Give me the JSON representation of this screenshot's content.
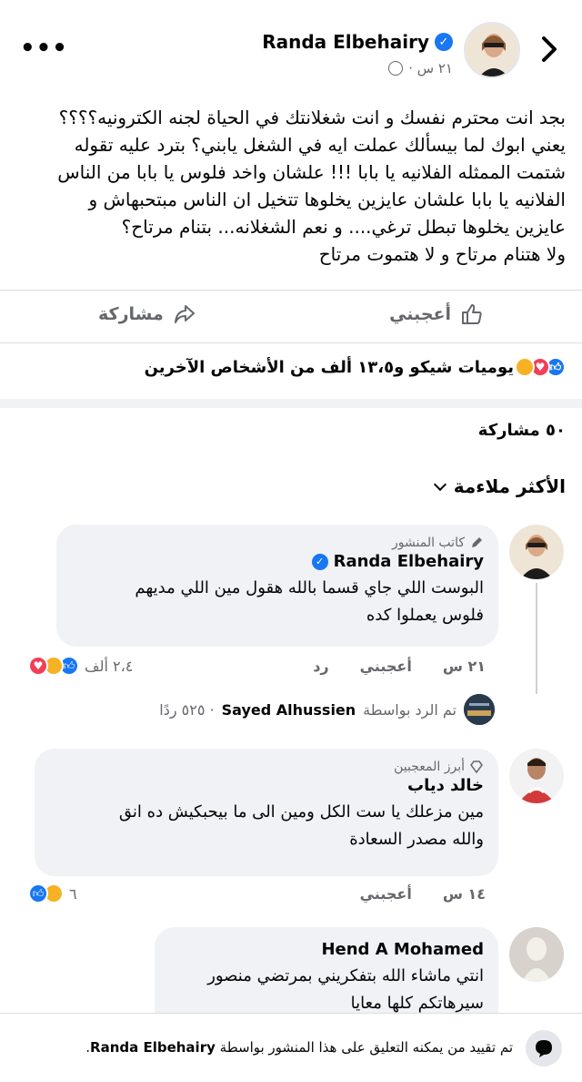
{
  "header": {
    "author": "Randa Elbehairy",
    "time": "٢١ س ·",
    "more_label": "•••"
  },
  "post": {
    "lines": [
      "بجد انت محترم نفسك و انت شغلانتك في الحياة لجنه الكترونيه؟؟؟؟",
      "يعني ابوك لما بيسألك عملت ايه في الشغل يابني؟ بترد عليه تقوله",
      "شتمت الممثله الفلانيه يا بابا !!! علشان واخد فلوس يا بابا من الناس",
      "الفلانيه يا بابا علشان عايزين يخلوها تتخيل ان الناس مبتحبهاش و",
      "عايزين يخلوها تبطل ترغي.... و نعم الشغلانه... بتنام مرتاح؟",
      "ولا هتنام مرتاح و لا هتموت مرتاح"
    ]
  },
  "actions": {
    "like_label": "أعجبني",
    "share_label": "مشاركة"
  },
  "reactions": {
    "summary": "يوميات شيكو و١٣،٥ ألف من الأشخاص الآخرين"
  },
  "shares": {
    "count_label": "٥٠ مشاركة"
  },
  "sort": {
    "label": "الأكثر ملاءمة"
  },
  "comments": [
    {
      "badge": "كاتب المنشور",
      "name": "Randa Elbehairy",
      "text_lines": [
        "البوست اللي جاي قسما بالله هقول مين اللي مديهم",
        "فلوس يعملوا كده"
      ],
      "time": "٢١ س",
      "like_label": "أعجبني",
      "reply_label": "رد",
      "reaction_count": "٢،٤ ألف",
      "replies": {
        "prefix": "تم الرد بواسطة",
        "name": "Sayed Alhussien",
        "count": "· ٥٢٥ ردًا"
      }
    },
    {
      "badge": "أبرز المعجبين",
      "name": "خالد دياب",
      "text_lines": [
        "مين مزعلك يا ست الكل ومين الى ما بيحبكيش ده انق",
        "والله مصدر السعادة"
      ],
      "time": "١٤ س",
      "like_label": "أعجبني",
      "reaction_count": "٦"
    },
    {
      "name": "Hend A Mohamed",
      "text_lines": [
        "انتي ماشاء الله بتفكريني بمرتضي منصور",
        "سيرهاتكم كلها معايا"
      ]
    }
  ],
  "footer": {
    "prefix": "تم تقييد من يمكنه التعليق على هذا المنشور بواسطة",
    "name": "Randa Elbehairy",
    "suffix": "."
  },
  "colors": {
    "accent": "#1877f2",
    "love": "#f33e58",
    "muted": "#65676b"
  }
}
